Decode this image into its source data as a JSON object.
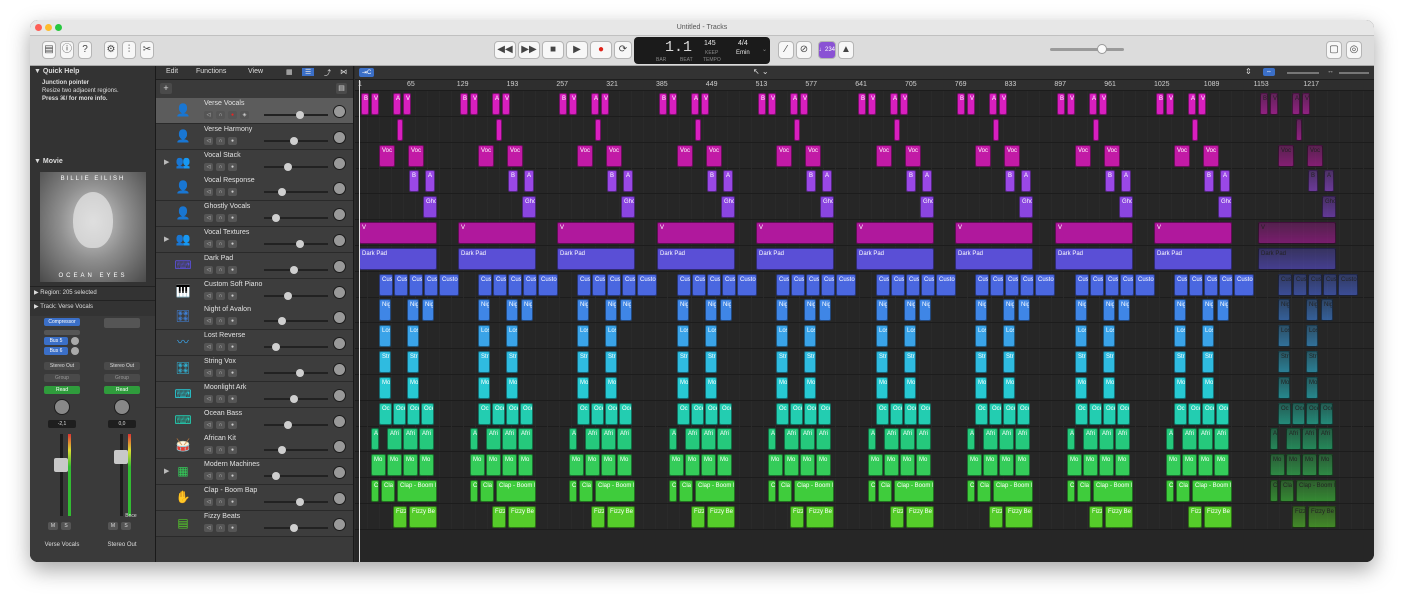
{
  "window": {
    "title": "Untitled - Tracks"
  },
  "toolbar": {
    "bar_beat": "1.1",
    "bar_label": "BAR",
    "beat_label": "BEAT",
    "tempo": "145",
    "tempo_mode": "KEEP",
    "tempo_label": "TEMPO",
    "time_sig": "4/4",
    "key": "Emin",
    "count_in": "♩234"
  },
  "quick_help": {
    "title": "Quick Help",
    "heading": "Junction pointer",
    "body": "Resize two adjacent regions.",
    "hint": "Press ⌘/ for more info."
  },
  "movie": {
    "title": "Movie",
    "artist": "BILLIE EILISH",
    "song": "OCEAN EYES"
  },
  "region_inspector": {
    "label": "Region: 205 selected"
  },
  "track_inspector": {
    "label": "Track: Verse Vocals"
  },
  "mixer": {
    "strip1": {
      "plugin": "Compressor",
      "sends": [
        "Bus 5",
        "Bus 6"
      ],
      "output": "Stereo Out",
      "group": "Group",
      "automation": "Read",
      "value": "-2,1",
      "name": "Verse Vocals",
      "mute": "M",
      "solo": "S"
    },
    "strip2": {
      "output": "Stereo Out",
      "group": "Group",
      "automation": "Read",
      "value": "0,0",
      "mode": "Bnce",
      "name": "Stereo Out",
      "mute": "M",
      "solo": "S"
    }
  },
  "menus": {
    "edit": "Edit",
    "functions": "Functions",
    "view": "View"
  },
  "tracks": [
    {
      "name": "Verse Vocals",
      "icon": "singer-icon",
      "color": "#d81fbf"
    },
    {
      "name": "Verse Harmony",
      "icon": "singer-icon",
      "color": "#d81fbf"
    },
    {
      "name": "Vocal Stack",
      "icon": "choir-icon",
      "color": "#c21aa6"
    },
    {
      "name": "Vocal Response",
      "icon": "singer-icon",
      "color": "#9a48e6"
    },
    {
      "name": "Ghostly Vocals",
      "icon": "singer-icon",
      "color": "#8a45e0"
    },
    {
      "name": "Vocal Textures",
      "icon": "choir-icon",
      "color": "#b0189d"
    },
    {
      "name": "Dark Pad",
      "icon": "keyboard-icon",
      "color": "#5a4fd6"
    },
    {
      "name": "Custom Soft Piano",
      "icon": "piano-icon",
      "color": "#4a67e0"
    },
    {
      "name": "Night of Avalon",
      "icon": "synth-icon",
      "color": "#3f86e6"
    },
    {
      "name": "Lost Reverse",
      "icon": "waveform-icon",
      "color": "#3aa3e8"
    },
    {
      "name": "String Vox",
      "icon": "synth-icon",
      "color": "#2fbbe0"
    },
    {
      "name": "Moonlight Ark",
      "icon": "keyboard-icon",
      "color": "#27c9d3"
    },
    {
      "name": "Ocean Bass",
      "icon": "keyboard-icon",
      "color": "#23cdb1"
    },
    {
      "name": "African Kit",
      "icon": "drum-icon",
      "color": "#25c97c"
    },
    {
      "name": "Modern Machines",
      "icon": "drum-machine-icon",
      "color": "#34cc59"
    },
    {
      "name": "Clap - Boom Bap",
      "icon": "clap-icon",
      "color": "#3fcc3c"
    },
    {
      "name": "Fizzy Beats",
      "icon": "beat-icon",
      "color": "#55cc2a"
    }
  ],
  "ruler": [
    "1",
    "65",
    "129",
    "193",
    "257",
    "321",
    "385",
    "449",
    "513",
    "577",
    "641",
    "705",
    "769",
    "833",
    "897",
    "961",
    "1025",
    "1089",
    "1153",
    "1217"
  ],
  "region_labels": {
    "vv": [
      "B",
      "V",
      "A",
      "V"
    ],
    "voc": "Voc",
    "resp": [
      "B",
      "A"
    ],
    "gho": "Gho",
    "tex": "V",
    "pad": "Dark Pad",
    "piano": [
      "Cus",
      "Cus",
      "Cus",
      "Cus",
      "Custo"
    ],
    "nig": "Nig",
    "los": "Los",
    "str": "Stri",
    "mo": "Mo",
    "oce": [
      "Oc",
      "Oce",
      "Oce",
      "Oce"
    ],
    "afr": [
      "A",
      "Afri",
      "Afri",
      "Afri"
    ],
    "mm": [
      "Mo",
      "Mo",
      "Mo",
      "Mo"
    ],
    "clap": [
      "C",
      "Cla",
      "Clap - Boom B"
    ],
    "fizzy": [
      "Fizzy",
      "Fizzy Be"
    ]
  }
}
